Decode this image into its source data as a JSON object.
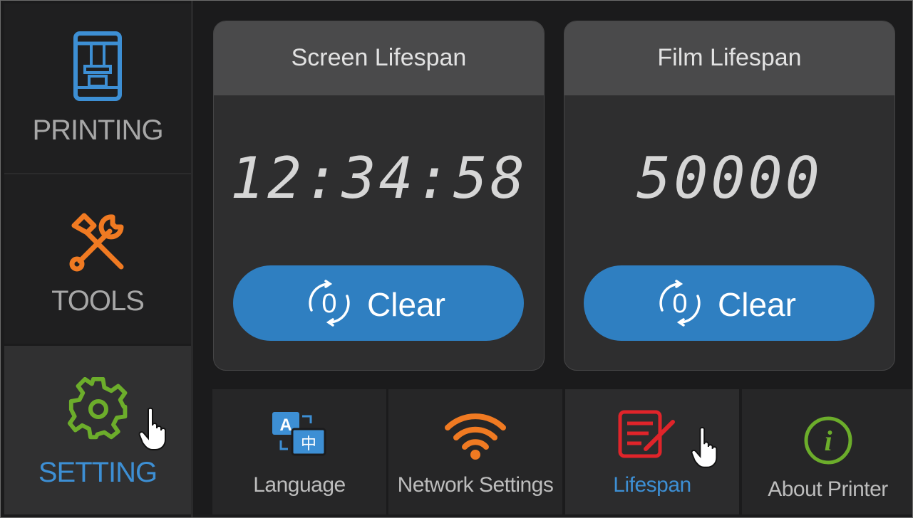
{
  "sidebar": {
    "items": [
      {
        "label": "PRINTING",
        "icon": "printer-icon"
      },
      {
        "label": "TOOLS",
        "icon": "tools-icon"
      },
      {
        "label": "SETTING",
        "icon": "gear-icon",
        "active": true
      }
    ]
  },
  "cards": [
    {
      "title": "Screen Lifespan",
      "value": "12:34:58",
      "button_label": "Clear",
      "button_icon": "reset-icon"
    },
    {
      "title": "Film Lifespan",
      "value": "50000",
      "button_label": "Clear",
      "button_icon": "reset-icon"
    }
  ],
  "tabs": [
    {
      "label": "Language",
      "icon": "language-icon"
    },
    {
      "label": "Network Settings",
      "icon": "wifi-icon"
    },
    {
      "label": "Lifespan",
      "icon": "lifespan-icon",
      "active": true
    },
    {
      "label": "About Printer",
      "icon": "info-icon"
    }
  ],
  "colors": {
    "accent_blue": "#3d8fd4",
    "button_blue": "#2f7fc1",
    "tools_orange": "#f07a22",
    "setting_green": "#6cad2b",
    "lifespan_red": "#e0242a",
    "wifi_orange": "#f07a22"
  }
}
